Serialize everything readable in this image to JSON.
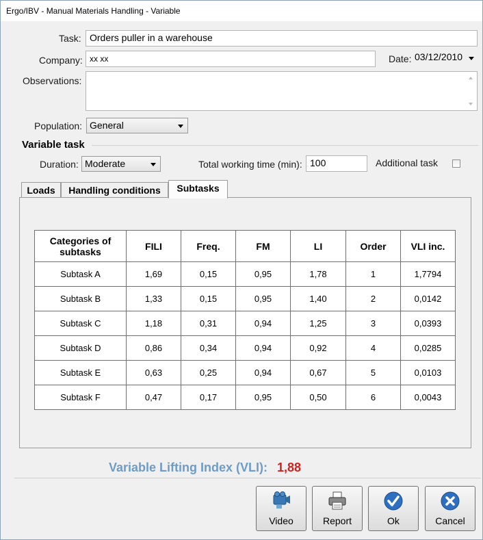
{
  "window": {
    "title": "Ergo/IBV - Manual Materials Handling - Variable"
  },
  "form": {
    "task_label": "Task:",
    "task_value": "Orders puller in a warehouse",
    "company_label": "Company:",
    "company_value": "xx xx",
    "date_label": "Date:",
    "date_value": "03/12/2010",
    "observations_label": "Observations:",
    "observations_value": "",
    "population_label": "Population:",
    "population_value": "General"
  },
  "variable_task": {
    "title": "Variable task",
    "duration_label": "Duration:",
    "duration_value": "Moderate",
    "total_time_label": "Total working time (min):",
    "total_time_value": "100",
    "additional_task_label": "Additional task",
    "additional_task_checked": false
  },
  "tabs": [
    {
      "label": "Loads"
    },
    {
      "label": "Handling conditions"
    },
    {
      "label": "Subtasks"
    }
  ],
  "subtasks_table": {
    "headers": [
      "Categories of subtasks",
      "FILI",
      "Freq.",
      "FM",
      "LI",
      "Order",
      "VLI inc."
    ],
    "rows": [
      [
        "Subtask A",
        "1,69",
        "0,15",
        "0,95",
        "1,78",
        "1",
        "1,7794"
      ],
      [
        "Subtask B",
        "1,33",
        "0,15",
        "0,95",
        "1,40",
        "2",
        "0,0142"
      ],
      [
        "Subtask C",
        "1,18",
        "0,31",
        "0,94",
        "1,25",
        "3",
        "0,0393"
      ],
      [
        "Subtask D",
        "0,86",
        "0,34",
        "0,94",
        "0,92",
        "4",
        "0,0285"
      ],
      [
        "Subtask E",
        "0,63",
        "0,25",
        "0,94",
        "0,67",
        "5",
        "0,0103"
      ],
      [
        "Subtask F",
        "0,47",
        "0,17",
        "0,95",
        "0,50",
        "6",
        "0,0043"
      ]
    ]
  },
  "result": {
    "label": "Variable Lifting Index (VLI):",
    "value": "1,88",
    "label_color": "#6f9cc6",
    "value_color": "#d21f1f"
  },
  "buttons": {
    "video": "Video",
    "report": "Report",
    "ok": "Ok",
    "cancel": "Cancel"
  }
}
